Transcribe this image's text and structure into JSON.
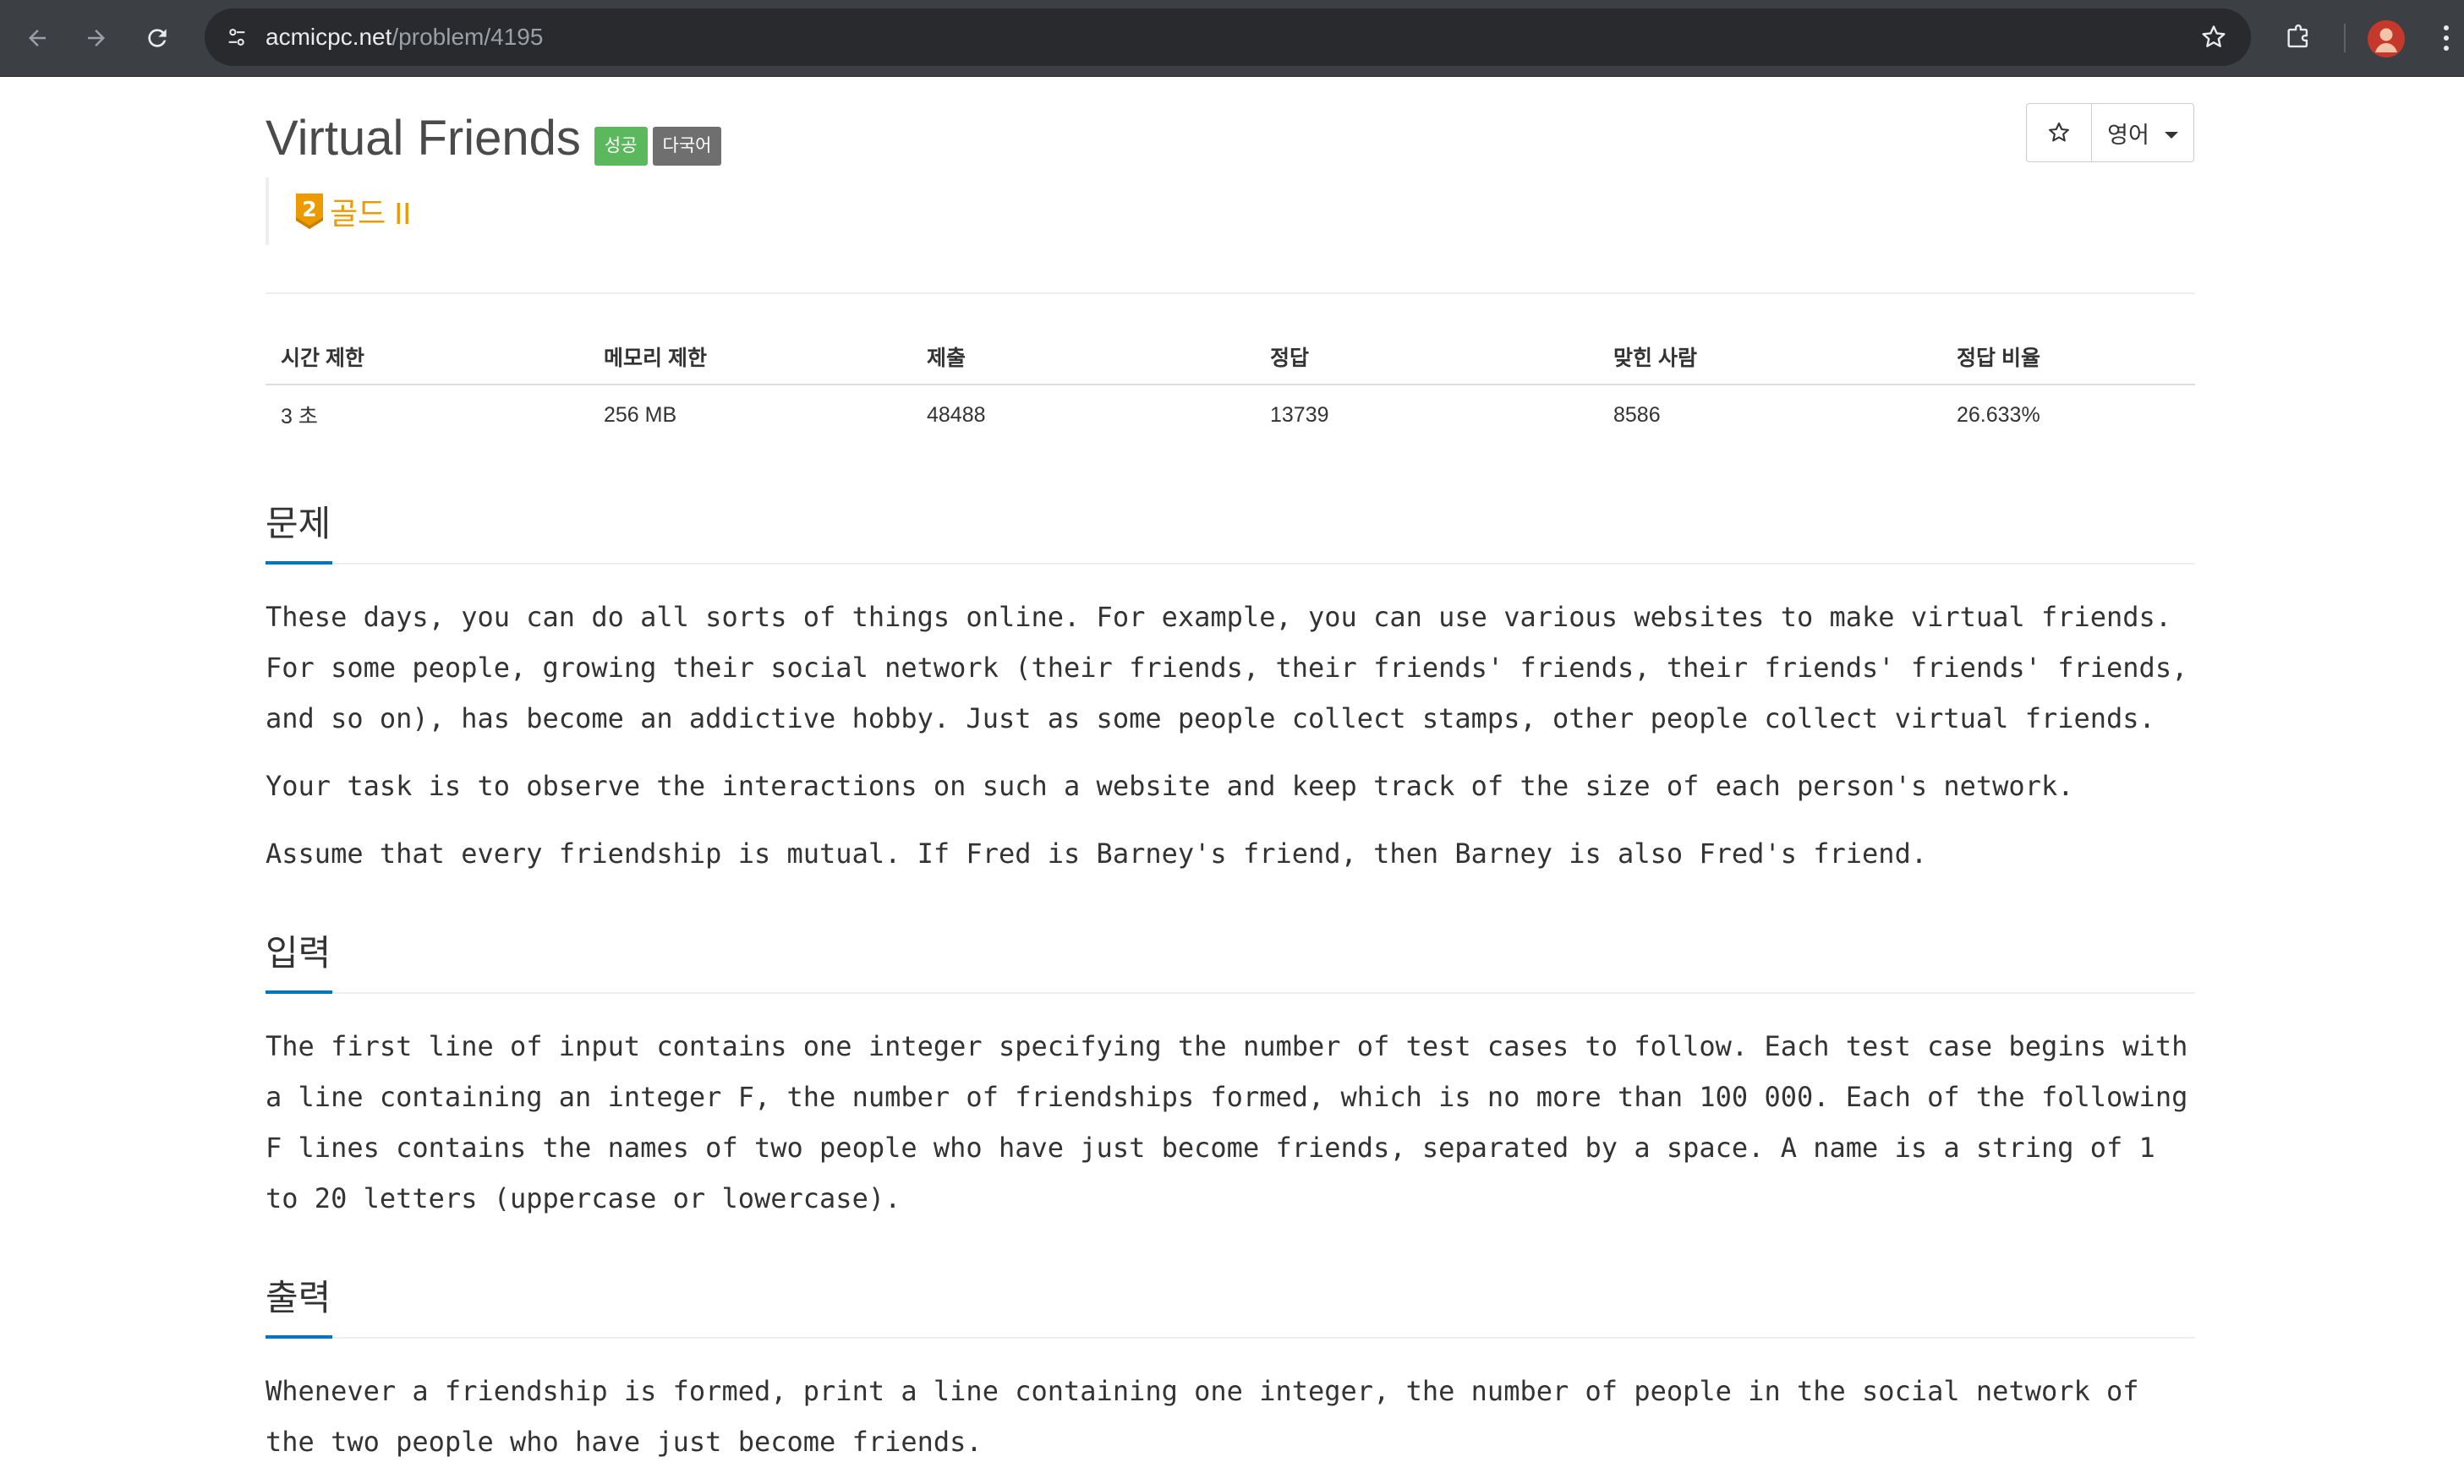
{
  "browser": {
    "url_host": "acmicpc.net",
    "url_path": "/problem/4195",
    "back_icon": "arrow-left-icon",
    "forward_icon": "arrow-right-icon",
    "reload_icon": "reload-icon",
    "site_info_icon": "tune-icon",
    "bookmark_icon": "star-outline-icon",
    "extensions_icon": "puzzle-icon",
    "profile_icon": "avatar-icon",
    "menu_icon": "kebab-menu-icon",
    "colors": {
      "toolbar": "#3c3f43",
      "omnibox": "#282a2d",
      "profile": "#c5382c"
    }
  },
  "problem": {
    "title": "Virtual Friends",
    "labels": {
      "success": "성공",
      "multilang": "다국어"
    },
    "tier": {
      "level": "2",
      "name": "골드 II",
      "color": "#ec9a00"
    },
    "actions": {
      "star_icon": "star-outline-icon",
      "language": "영어"
    },
    "colors": {
      "success": "#5cb85c",
      "multilang": "#6f6f6f",
      "section_accent": "#0076c0"
    }
  },
  "info_table": {
    "headers": [
      "시간 제한",
      "메모리 제한",
      "제출",
      "정답",
      "맞힌 사람",
      "정답 비율"
    ],
    "values": [
      "3 초",
      "256 MB",
      "48488",
      "13739",
      "8586",
      "26.633%"
    ]
  },
  "sections": {
    "description": {
      "title": "문제",
      "lines": [
        "These days, you can do all sorts of things online. For example, you can use various websites to make virtual friends.",
        "For some people, growing their social network (their friends, their friends' friends, their friends' friends' friends,",
        "and so on), has become an addictive hobby. Just as some people collect stamps, other people collect virtual friends.",
        "Your task is to observe the interactions on such a website and keep track of the size of each person's network.",
        "Assume that every friendship is mutual. If Fred is Barney's friend, then Barney is also Fred's friend."
      ]
    },
    "input": {
      "title": "입력",
      "lines": [
        "The first line of input contains one integer specifying the number of test cases to follow. Each test case begins with",
        "a line containing an integer F, the number of friendships formed, which is no more than 100 000. Each of the following",
        "F lines contains the names of two people who have just become friends, separated by a space. A name is a string of 1",
        "to 20 letters (uppercase or lowercase)."
      ]
    },
    "output": {
      "title": "출력",
      "lines": [
        "Whenever a friendship is formed, print a line containing one integer, the number of people in the social network of",
        "the two people who have just become friends."
      ]
    }
  }
}
